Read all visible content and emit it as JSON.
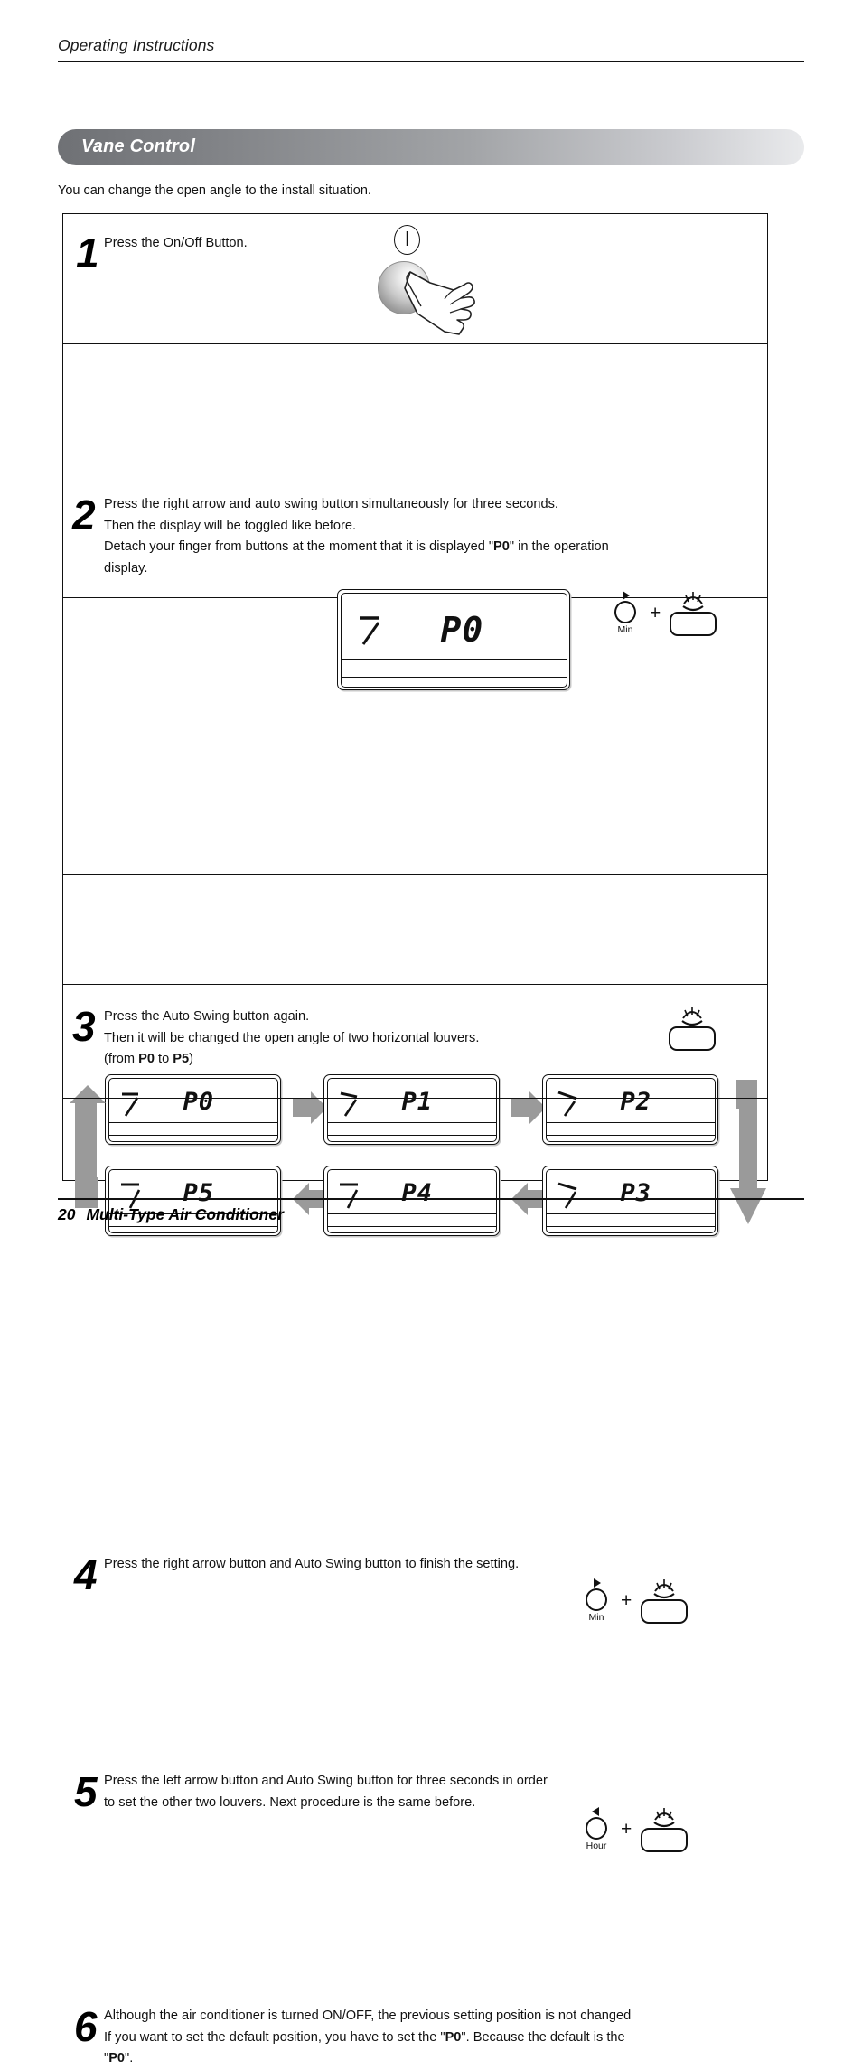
{
  "header": {
    "title": "Operating Instructions"
  },
  "section": {
    "title": "Vane Control",
    "intro": "You can change the open angle to the install situation."
  },
  "steps": [
    {
      "number": "1",
      "lines": [
        "Press the On/Off Button."
      ],
      "icon": "power-button"
    },
    {
      "number": "2",
      "lines": [
        "Press the right arrow and auto swing button simultaneously for three seconds.",
        "Then the display will be toggled like before.",
        "Detach your finger from buttons at the moment that it is displayed \"P0\" in the operation",
        "display."
      ],
      "display_code": "P0",
      "buttons": {
        "arrow_label": "Min",
        "arrow_direction": "right",
        "plus": "+",
        "swing": "auto-swing"
      }
    },
    {
      "number": "3",
      "lines": [
        "Press the Auto Swing button again.",
        "Then it will be changed the open angle of two horizontal louvers.",
        "(from P0 to P5)"
      ],
      "cycle_codes": [
        "P0",
        "P1",
        "P2",
        "P3",
        "P4",
        "P5"
      ]
    },
    {
      "number": "4",
      "lines": [
        "Press the right arrow button and Auto Swing button to finish the setting."
      ],
      "buttons": {
        "arrow_label": "Min",
        "arrow_direction": "right",
        "plus": "+",
        "swing": "auto-swing"
      }
    },
    {
      "number": "5",
      "lines": [
        "Press the left arrow button and Auto Swing button for three seconds in order",
        "to set the other two louvers. Next procedure is the same before."
      ],
      "buttons": {
        "arrow_label": "Hour",
        "arrow_direction": "left",
        "plus": "+",
        "swing": "auto-swing"
      }
    },
    {
      "number": "6",
      "lines": [
        "Although the air conditioner is turned ON/OFF, the previous setting position is not changed",
        "If you want to set the default position, you have to set the \"P0\". Because the default is the",
        "\"P0\"."
      ]
    }
  ],
  "footer": {
    "page": "20",
    "title": "Multi-Type Air Conditioner"
  },
  "colors": {
    "arrow_gray": "#9a9a9a",
    "pill_dark": "#6f7175",
    "pill_light": "#e9eaec",
    "ink": "#111111"
  }
}
